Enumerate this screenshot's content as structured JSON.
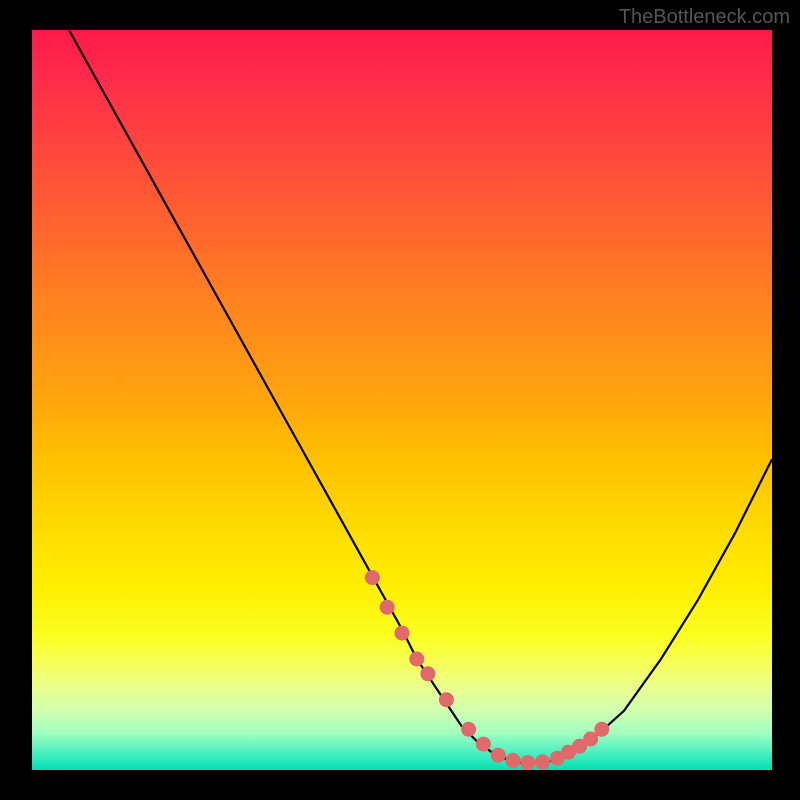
{
  "attribution": "TheBottleneck.com",
  "chart_data": {
    "type": "line",
    "title": "",
    "xlabel": "",
    "ylabel": "",
    "xlim": [
      0,
      100
    ],
    "ylim": [
      0,
      100
    ],
    "series": [
      {
        "name": "curve",
        "x": [
          5,
          10,
          15,
          20,
          25,
          30,
          35,
          40,
          45,
          50,
          52,
          54,
          56,
          58,
          60,
          62,
          64,
          66,
          68,
          70,
          72,
          75,
          80,
          85,
          90,
          95,
          100
        ],
        "y": [
          100,
          91,
          82,
          73,
          64,
          55,
          46,
          37,
          28,
          19,
          15,
          12,
          9,
          6,
          4,
          2.5,
          1.5,
          1,
          1,
          1.2,
          2,
          3.5,
          8,
          15,
          23,
          32,
          42
        ]
      }
    ],
    "markers": {
      "name": "highlight-points",
      "color": "#e06a6a",
      "x": [
        46,
        48,
        50,
        52,
        53.5,
        56,
        59,
        61,
        63,
        65,
        67,
        69,
        71,
        72.5,
        74,
        75.5,
        77
      ],
      "y": [
        26,
        22,
        18.5,
        15,
        13,
        9.5,
        5.5,
        3.5,
        2,
        1.3,
        1,
        1.1,
        1.6,
        2.4,
        3.2,
        4.2,
        5.5
      ]
    }
  }
}
